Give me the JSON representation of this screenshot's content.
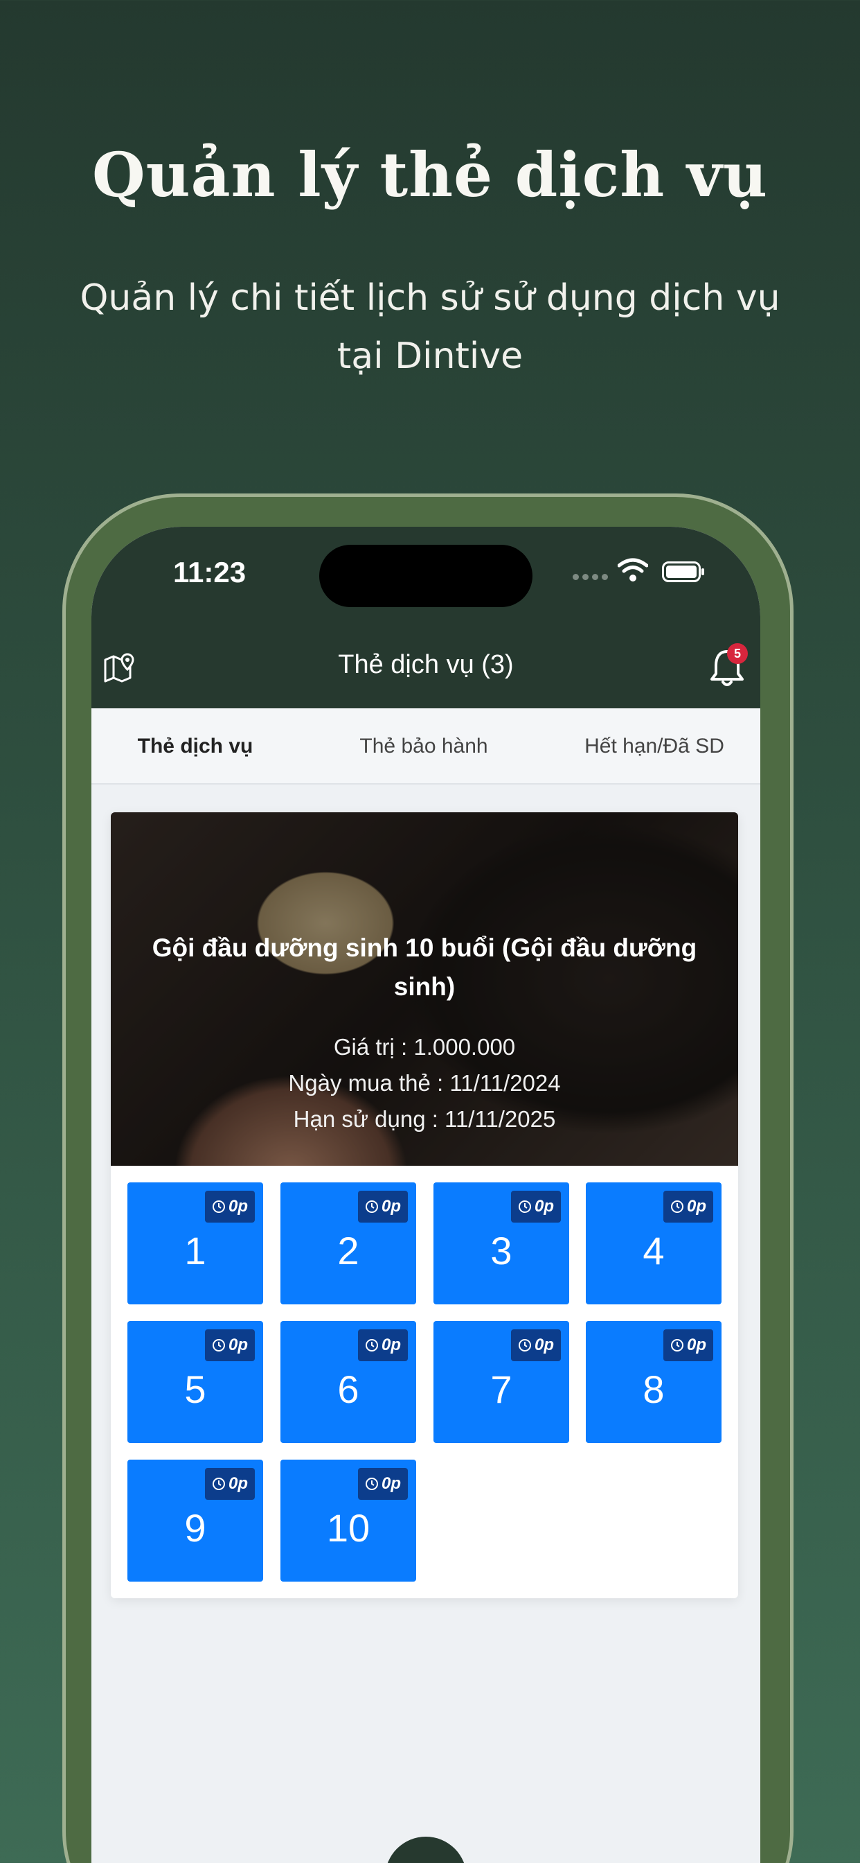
{
  "promo": {
    "title": "Quản lý thẻ dịch vụ",
    "subtitle": "Quản lý chi tiết lịch sử sử dụng dịch vụ tại Dintive"
  },
  "status_bar": {
    "time": "11:23"
  },
  "header": {
    "title": "Thẻ dịch vụ (3)",
    "notification_count": "5",
    "left_icon": "map-pin-icon",
    "right_icon": "bell-icon"
  },
  "tabs": [
    {
      "label": "Thẻ dịch vụ",
      "active": true
    },
    {
      "label": "Thẻ bảo hành",
      "active": false
    },
    {
      "label": "Hết hạn/Đã SD",
      "active": false
    }
  ],
  "card": {
    "title": "Gội đầu dưỡng sinh 10 buổi (Gội đầu dưỡng sinh)",
    "value_line": "Giá trị : 1.000.000",
    "purchase_line": "Ngày mua thẻ : 11/11/2024",
    "expiry_line": "Hạn sử dụng : 11/11/2025"
  },
  "sessions": [
    {
      "number": "1",
      "time": "0p"
    },
    {
      "number": "2",
      "time": "0p"
    },
    {
      "number": "3",
      "time": "0p"
    },
    {
      "number": "4",
      "time": "0p"
    },
    {
      "number": "5",
      "time": "0p"
    },
    {
      "number": "6",
      "time": "0p"
    },
    {
      "number": "7",
      "time": "0p"
    },
    {
      "number": "8",
      "time": "0p"
    },
    {
      "number": "9",
      "time": "0p"
    },
    {
      "number": "10",
      "time": "0p"
    }
  ],
  "colors": {
    "header_bg": "#26392f",
    "session_tile": "#0a7cff",
    "session_badge": "#0c3d8c",
    "badge_red": "#d7263d",
    "phone_frame": "#4e6b43"
  }
}
